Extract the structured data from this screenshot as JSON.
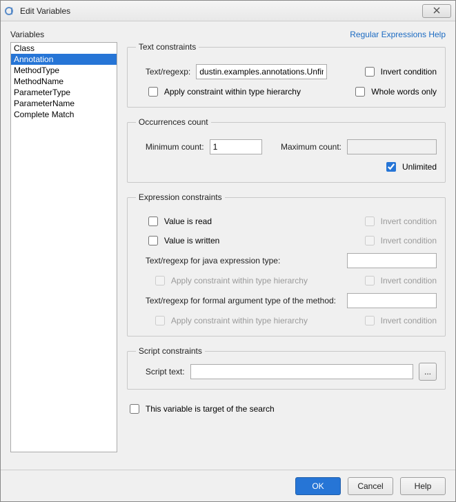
{
  "window": {
    "title": "Edit Variables"
  },
  "variables_label": "Variables",
  "help_link": "Regular Expressions Help",
  "variables": {
    "items": [
      {
        "label": "Class"
      },
      {
        "label": "Annotation",
        "selected": true
      },
      {
        "label": "MethodType"
      },
      {
        "label": "MethodName"
      },
      {
        "label": "ParameterType"
      },
      {
        "label": "ParameterName"
      },
      {
        "label": "Complete Match"
      }
    ]
  },
  "text_constraints": {
    "legend": "Text constraints",
    "text_regexp_label": "Text/regexp:",
    "text_regexp_value": "dustin.examples.annotations.Unfinished",
    "invert_label": "Invert condition",
    "apply_hierarchy_label": "Apply constraint within type hierarchy",
    "whole_words_label": "Whole words only"
  },
  "occurrences": {
    "legend": "Occurrences count",
    "min_label": "Minimum count:",
    "min_value": "1",
    "max_label": "Maximum count:",
    "max_value": "",
    "unlimited_label": "Unlimited",
    "unlimited_checked": true
  },
  "expression": {
    "legend": "Expression constraints",
    "value_read_label": "Value is read",
    "value_written_label": "Value is written",
    "invert_label": "Invert condition",
    "java_type_label": "Text/regexp for java expression type:",
    "apply_hierarchy_label": "Apply constraint within type hierarchy",
    "formal_arg_label": "Text/regexp for formal argument type of the method:"
  },
  "script": {
    "legend": "Script constraints",
    "script_text_label": "Script text:",
    "script_text_value": "",
    "browse_label": "..."
  },
  "target_label": "This variable is target of the search",
  "buttons": {
    "ok": "OK",
    "cancel": "Cancel",
    "help": "Help"
  }
}
